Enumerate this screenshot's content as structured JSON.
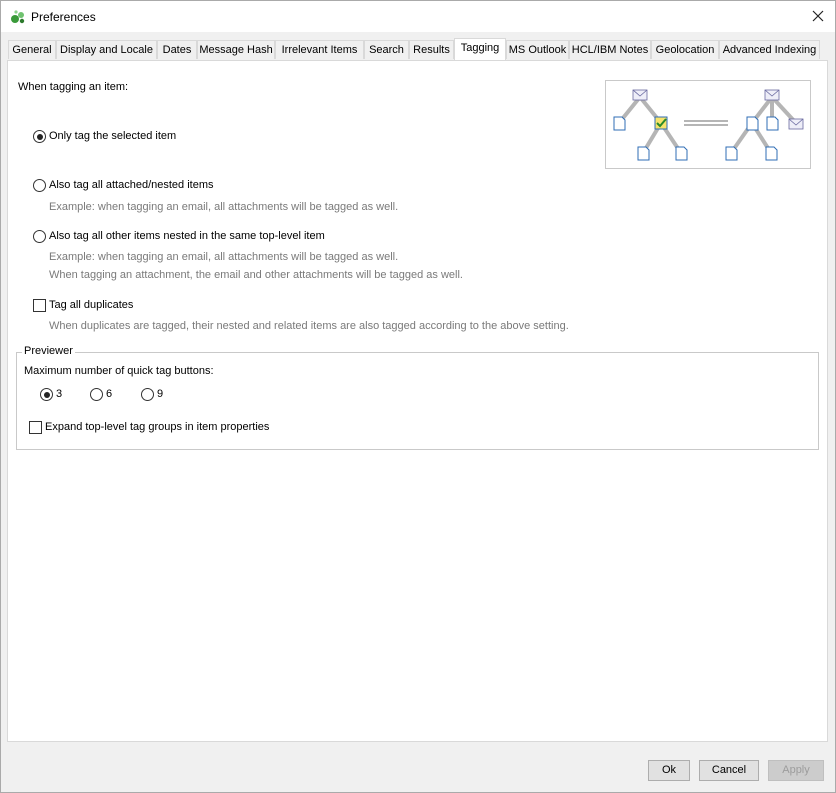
{
  "window": {
    "title": "Preferences"
  },
  "tabs": [
    {
      "label": "General"
    },
    {
      "label": "Display and Locale"
    },
    {
      "label": "Dates"
    },
    {
      "label": "Message Hash"
    },
    {
      "label": "Irrelevant Items"
    },
    {
      "label": "Search"
    },
    {
      "label": "Results"
    },
    {
      "label": "Tagging"
    },
    {
      "label": "MS Outlook"
    },
    {
      "label": "HCL/IBM Notes"
    },
    {
      "label": "Geolocation"
    },
    {
      "label": "Advanced Indexing"
    }
  ],
  "active_tab": "Tagging",
  "tagging": {
    "heading": "When tagging an item:",
    "options": [
      {
        "label": "Only tag the selected item",
        "checked": true
      },
      {
        "label": "Also tag all attached/nested items",
        "checked": false,
        "example": "Example: when tagging an email, all attachments will be tagged as well."
      },
      {
        "label": "Also tag all other items nested in the same top-level item",
        "checked": false,
        "example": "Example: when tagging an email, all attachments will be tagged as well.",
        "example2": "When tagging an attachment, the email and other attachments will be tagged as well."
      }
    ],
    "duplicates": {
      "label": "Tag all duplicates",
      "checked": false,
      "note": "When duplicates are tagged, their nested and related items are also tagged according to the above setting."
    }
  },
  "previewer": {
    "title": "Previewer",
    "max_label": "Maximum number of quick tag buttons:",
    "choices": [
      {
        "label": "3",
        "checked": true
      },
      {
        "label": "6",
        "checked": false
      },
      {
        "label": "9",
        "checked": false
      }
    ],
    "expand": {
      "label": "Expand top-level tag groups in item properties",
      "checked": false
    }
  },
  "buttons": {
    "ok": "Ok",
    "cancel": "Cancel",
    "apply": "Apply"
  },
  "colors": {
    "tree_line": "#b5b5b5",
    "doc_stroke": "#2f6db5",
    "tag_fill": "#f7e36b",
    "check": "#2a8a2a"
  }
}
